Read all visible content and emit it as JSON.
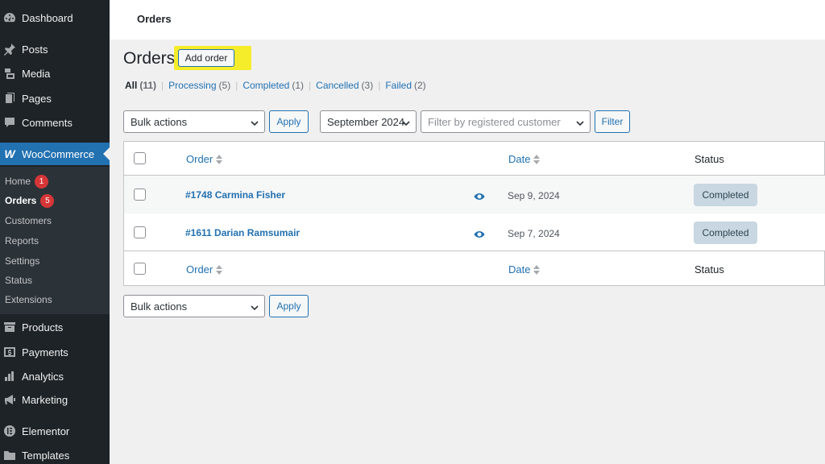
{
  "sidebar": {
    "items": [
      {
        "label": "Dashboard",
        "icon": "dashboard-icon"
      },
      {
        "label": "Posts",
        "icon": "pin-icon"
      },
      {
        "label": "Media",
        "icon": "media-icon"
      },
      {
        "label": "Pages",
        "icon": "pages-icon"
      },
      {
        "label": "Comments",
        "icon": "comment-icon"
      },
      {
        "label": "WooCommerce",
        "icon": "woocommerce-icon"
      },
      {
        "label": "Products",
        "icon": "archive-icon"
      },
      {
        "label": "Payments",
        "icon": "payments-icon"
      },
      {
        "label": "Analytics",
        "icon": "bar-chart-icon"
      },
      {
        "label": "Marketing",
        "icon": "megaphone-icon"
      },
      {
        "label": "Elementor",
        "icon": "elementor-icon"
      },
      {
        "label": "Templates",
        "icon": "folder-icon"
      }
    ],
    "submenu": [
      {
        "label": "Home",
        "badge": "1"
      },
      {
        "label": "Orders",
        "badge": "5"
      },
      {
        "label": "Customers"
      },
      {
        "label": "Reports"
      },
      {
        "label": "Settings"
      },
      {
        "label": "Status"
      },
      {
        "label": "Extensions"
      }
    ]
  },
  "header": {
    "breadcrumb": "Orders"
  },
  "page": {
    "title": "Orders",
    "add_order_label": "Add order",
    "highlight_color": "#f5ec2a"
  },
  "filters": {
    "statuses": [
      {
        "label": "All",
        "count": "(11)"
      },
      {
        "label": "Processing",
        "count": "(5)"
      },
      {
        "label": "Completed",
        "count": "(1)"
      },
      {
        "label": "Cancelled",
        "count": "(3)"
      },
      {
        "label": "Failed",
        "count": "(2)"
      }
    ],
    "separator": "|",
    "bulk_actions": "Bulk actions",
    "apply_label": "Apply",
    "month": "September 2024",
    "customer_placeholder": "Filter by registered customer",
    "filter_label": "Filter"
  },
  "table": {
    "columns": {
      "order": "Order",
      "date": "Date",
      "status": "Status"
    },
    "rows": [
      {
        "order": "#1748 Carmina Fisher",
        "date": "Sep 9, 2024",
        "status": "Completed"
      },
      {
        "order": "#1611 Darian Ramsumair",
        "date": "Sep 7, 2024",
        "status": "Completed"
      }
    ]
  },
  "bottom": {
    "bulk_actions": "Bulk actions",
    "apply_label": "Apply"
  },
  "colors": {
    "sidebar_bg": "#1d2327",
    "accent": "#2271b1",
    "badge": "#d63638",
    "status_completed_bg": "#c8d7e1"
  }
}
